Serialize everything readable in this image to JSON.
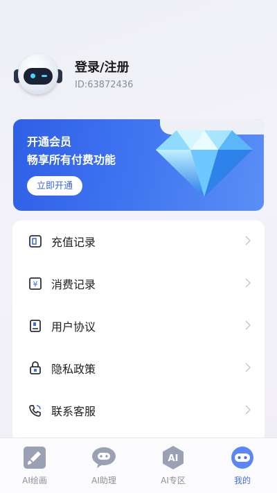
{
  "profile": {
    "name": "登录/注册",
    "id_text": "ID:63872436"
  },
  "vip": {
    "title": "开通会员",
    "subtitle": "畅享所有付费功能",
    "button_label": "立即开通"
  },
  "menu": {
    "items": [
      {
        "label": "充值记录",
        "icon": "wallet-icon"
      },
      {
        "label": "消费记录",
        "icon": "yen-receipt-icon"
      },
      {
        "label": "用户协议",
        "icon": "agreement-icon"
      },
      {
        "label": "隐私政策",
        "icon": "lock-icon"
      },
      {
        "label": "联系客服",
        "icon": "phone-icon"
      }
    ]
  },
  "bottom_nav": {
    "items": [
      {
        "label": "AI绘画",
        "icon": "paint-brush-icon",
        "active": false
      },
      {
        "label": "AI助理",
        "icon": "chat-bubble-icon",
        "active": false
      },
      {
        "label": "AI专区",
        "icon": "ai-hexagon-icon",
        "icon_text": "AI",
        "active": false
      },
      {
        "label": "我的",
        "icon": "robot-face-icon",
        "active": true
      }
    ]
  },
  "colors": {
    "accent": "#3d6cf0",
    "banner_start": "#2f5fe6",
    "banner_end": "#5a8ff6",
    "inactive_icon": "#9aa1b5"
  }
}
